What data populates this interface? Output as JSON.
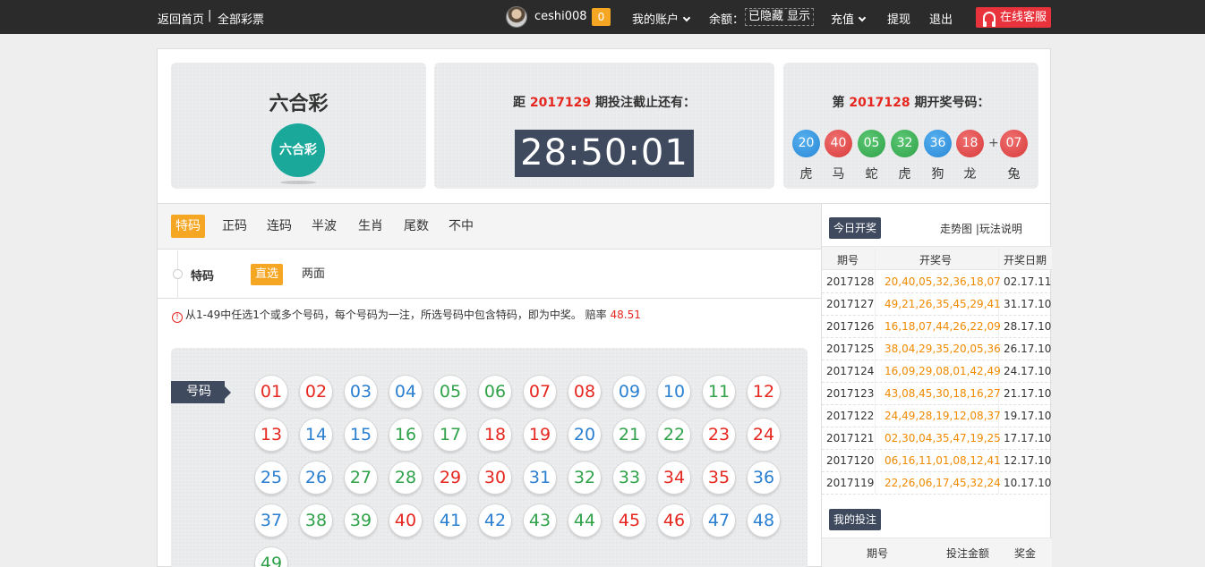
{
  "topbar": {
    "home": "返回首页",
    "divider": "|",
    "all_lottery": "全部彩票",
    "username": "ceshi008",
    "message_count": "0",
    "my_account": "我的账户",
    "balance_label": "余额：",
    "balance_hidden": "已隐藏",
    "balance_show": "显示",
    "recharge": "充值",
    "withdraw": "提现",
    "logout": "退出",
    "service": "在线客服"
  },
  "lottery": {
    "name": "六合彩",
    "logo_text": "六合彩"
  },
  "countdown": {
    "prefix": "距",
    "period": "2017129",
    "suffix": "期投注截止还有：",
    "time": "28:50:01"
  },
  "last_draw": {
    "prefix": "第",
    "period": "2017128",
    "suffix": "期开奖号码：",
    "plus": "+",
    "balls": [
      {
        "num": "20",
        "color": "blue",
        "zodiac": "虎"
      },
      {
        "num": "40",
        "color": "red",
        "zodiac": "马"
      },
      {
        "num": "05",
        "color": "green",
        "zodiac": "蛇"
      },
      {
        "num": "32",
        "color": "green",
        "zodiac": "虎"
      },
      {
        "num": "36",
        "color": "blue",
        "zodiac": "狗"
      },
      {
        "num": "18",
        "color": "red",
        "zodiac": "龙"
      },
      {
        "num": "07",
        "color": "red",
        "zodiac": "兔"
      }
    ]
  },
  "tabs": [
    "特码",
    "正码",
    "连码",
    "半波",
    "生肖",
    "尾数",
    "不中"
  ],
  "subrow": {
    "label": "特码",
    "options": [
      "直选",
      "两面"
    ]
  },
  "info": {
    "icon": "!",
    "text": "从1-49中任选1个或多个号码，每个号码为一注，所选号码中包含特码，即为中奖。 赔率",
    "odds": "48.51"
  },
  "numbers": {
    "label": "号码",
    "balls": [
      {
        "n": "01",
        "c": "red"
      },
      {
        "n": "02",
        "c": "red"
      },
      {
        "n": "03",
        "c": "blue"
      },
      {
        "n": "04",
        "c": "blue"
      },
      {
        "n": "05",
        "c": "green"
      },
      {
        "n": "06",
        "c": "green"
      },
      {
        "n": "07",
        "c": "red"
      },
      {
        "n": "08",
        "c": "red"
      },
      {
        "n": "09",
        "c": "blue"
      },
      {
        "n": "10",
        "c": "blue"
      },
      {
        "n": "11",
        "c": "green"
      },
      {
        "n": "12",
        "c": "red"
      },
      {
        "n": "13",
        "c": "red"
      },
      {
        "n": "14",
        "c": "blue"
      },
      {
        "n": "15",
        "c": "blue"
      },
      {
        "n": "16",
        "c": "green"
      },
      {
        "n": "17",
        "c": "green"
      },
      {
        "n": "18",
        "c": "red"
      },
      {
        "n": "19",
        "c": "red"
      },
      {
        "n": "20",
        "c": "blue"
      },
      {
        "n": "21",
        "c": "green"
      },
      {
        "n": "22",
        "c": "green"
      },
      {
        "n": "23",
        "c": "red"
      },
      {
        "n": "24",
        "c": "red"
      },
      {
        "n": "25",
        "c": "blue"
      },
      {
        "n": "26",
        "c": "blue"
      },
      {
        "n": "27",
        "c": "green"
      },
      {
        "n": "28",
        "c": "green"
      },
      {
        "n": "29",
        "c": "red"
      },
      {
        "n": "30",
        "c": "red"
      },
      {
        "n": "31",
        "c": "blue"
      },
      {
        "n": "32",
        "c": "green"
      },
      {
        "n": "33",
        "c": "green"
      },
      {
        "n": "34",
        "c": "red"
      },
      {
        "n": "35",
        "c": "red"
      },
      {
        "n": "36",
        "c": "blue"
      },
      {
        "n": "37",
        "c": "blue"
      },
      {
        "n": "38",
        "c": "green"
      },
      {
        "n": "39",
        "c": "green"
      },
      {
        "n": "40",
        "c": "red"
      },
      {
        "n": "41",
        "c": "blue"
      },
      {
        "n": "42",
        "c": "blue"
      },
      {
        "n": "43",
        "c": "green"
      },
      {
        "n": "44",
        "c": "green"
      },
      {
        "n": "45",
        "c": "red"
      },
      {
        "n": "46",
        "c": "red"
      },
      {
        "n": "47",
        "c": "blue"
      },
      {
        "n": "48",
        "c": "blue"
      },
      {
        "n": "49",
        "c": "green"
      }
    ]
  },
  "right": {
    "today_draw": "今日开奖",
    "trend": "走势图",
    "link_sep": "|",
    "rules": "玩法说明",
    "headers": [
      "期号",
      "开奖号",
      "开奖日期"
    ],
    "rows": [
      {
        "period": "2017128",
        "nums": "20,40,05,32,36,18,07",
        "date": "02.17.11"
      },
      {
        "period": "2017127",
        "nums": "49,21,26,35,45,29,41",
        "date": "31.17.10"
      },
      {
        "period": "2017126",
        "nums": "16,18,07,44,26,22,09",
        "date": "28.17.10"
      },
      {
        "period": "2017125",
        "nums": "38,04,29,35,20,05,36",
        "date": "26.17.10"
      },
      {
        "period": "2017124",
        "nums": "16,09,29,08,01,42,49",
        "date": "24.17.10"
      },
      {
        "period": "2017123",
        "nums": "43,08,45,30,18,16,27",
        "date": "21.17.10"
      },
      {
        "period": "2017122",
        "nums": "24,49,28,19,12,08,37",
        "date": "19.17.10"
      },
      {
        "period": "2017121",
        "nums": "02,30,04,35,47,19,25",
        "date": "17.17.10"
      },
      {
        "period": "2017120",
        "nums": "06,16,11,01,08,12,41",
        "date": "12.17.10"
      },
      {
        "period": "2017119",
        "nums": "22,26,06,17,45,32,24",
        "date": "10.17.10"
      }
    ],
    "my_bets": "我的投注",
    "bet_headers": [
      "期号",
      "投注金额",
      "奖金"
    ]
  }
}
